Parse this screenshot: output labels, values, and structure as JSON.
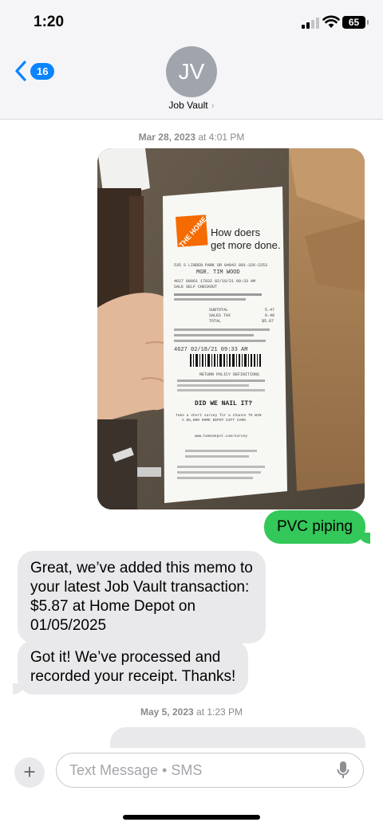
{
  "status": {
    "time": "1:20",
    "battery": "65"
  },
  "header": {
    "back_count": "16",
    "avatar_initials": "JV",
    "contact_name": "Job Vault",
    "contact_chevron": "›"
  },
  "thread": {
    "date1_day": "Mar 28, 2023",
    "date1_time": "at 4:01 PM",
    "receipt": {
      "slogan_line1": "How doers",
      "slogan_line2": "get more done.",
      "store_line": "535 S LINDEN PARK DR 04042 801-326-2253",
      "manager": "MGR. TIM WOOD",
      "line_a": "4627 00061 17832 02/18/21 09:33 AM",
      "line_b": "SALE SELF CHECKOUT",
      "subtotal_label": "SUBTOTAL",
      "subtotal": "5.47",
      "tax_label": "SALES TAX",
      "tax": "0.40",
      "total_label": "TOTAL",
      "total": "$5.87",
      "barcode_date": "4627 02/18/21 09:33 AM",
      "return_title": "RETURN POLICY DEFINITIONS",
      "nail_it": "DID WE NAIL IT?",
      "survey_line1": "Take a short survey for a chance TO WIN",
      "survey_line2": "A $5,000 HOME DEPOT GIFT CARD",
      "survey_url": "www.homedepot.com/survey"
    },
    "out_message": "PVC piping",
    "in_message1": [
      "Great, we’ve added this memo to",
      "your latest Job Vault transaction:",
      "$5.87 at Home Depot on",
      "01/05/2025"
    ],
    "in_message2": [
      "Got it! We’ve processed and",
      "recorded your receipt. Thanks!"
    ],
    "date2_day": "May 5, 2023",
    "date2_time": "at 1:23 PM"
  },
  "composer": {
    "placeholder": "Text Message • SMS",
    "plus_label": "+"
  },
  "colors": {
    "imessage_blue": "#0a84ff",
    "sms_green": "#34c759",
    "incoming_gray": "#e9e9eb"
  },
  "icons": [
    "back-chevron-icon",
    "signal-icon",
    "wifi-icon",
    "battery-icon",
    "plus-icon",
    "microphone-icon",
    "home-depot-logo"
  ]
}
